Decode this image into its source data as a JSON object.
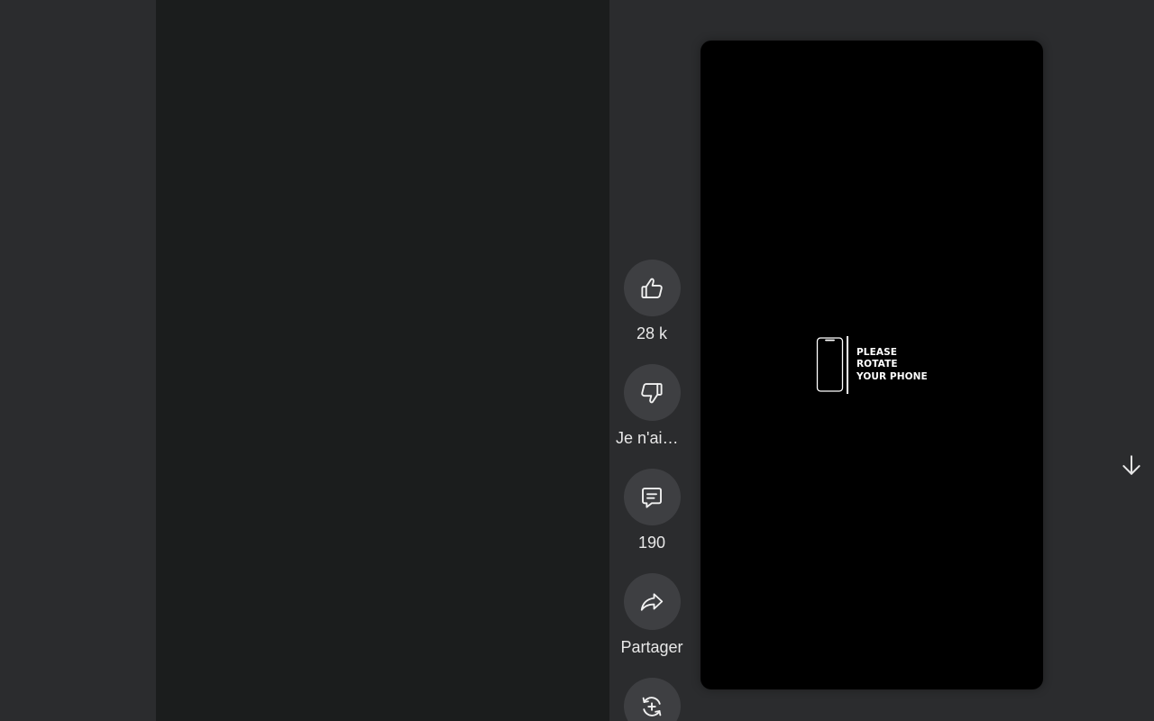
{
  "video": {
    "rotate_lines": [
      "PLEASE",
      "ROTATE",
      "YOUR PHONE"
    ]
  },
  "actions": {
    "like": {
      "icon": "thumbs-up-icon",
      "label": "28 k"
    },
    "dislike": {
      "icon": "thumbs-down-icon",
      "label": "Je n'aim…"
    },
    "comments": {
      "icon": "comment-icon",
      "label": "190"
    },
    "share": {
      "icon": "share-icon",
      "label": "Partager"
    },
    "remix": {
      "icon": "remix-icon",
      "label": ""
    }
  },
  "navigation": {
    "next_icon": "arrow-down-icon"
  },
  "colors": {
    "page_background": "#2b2c2e",
    "side_panel": "#1b1d1d",
    "video_background": "#000000",
    "button_background": "#3e3f42",
    "text": "#e8e8e8"
  }
}
